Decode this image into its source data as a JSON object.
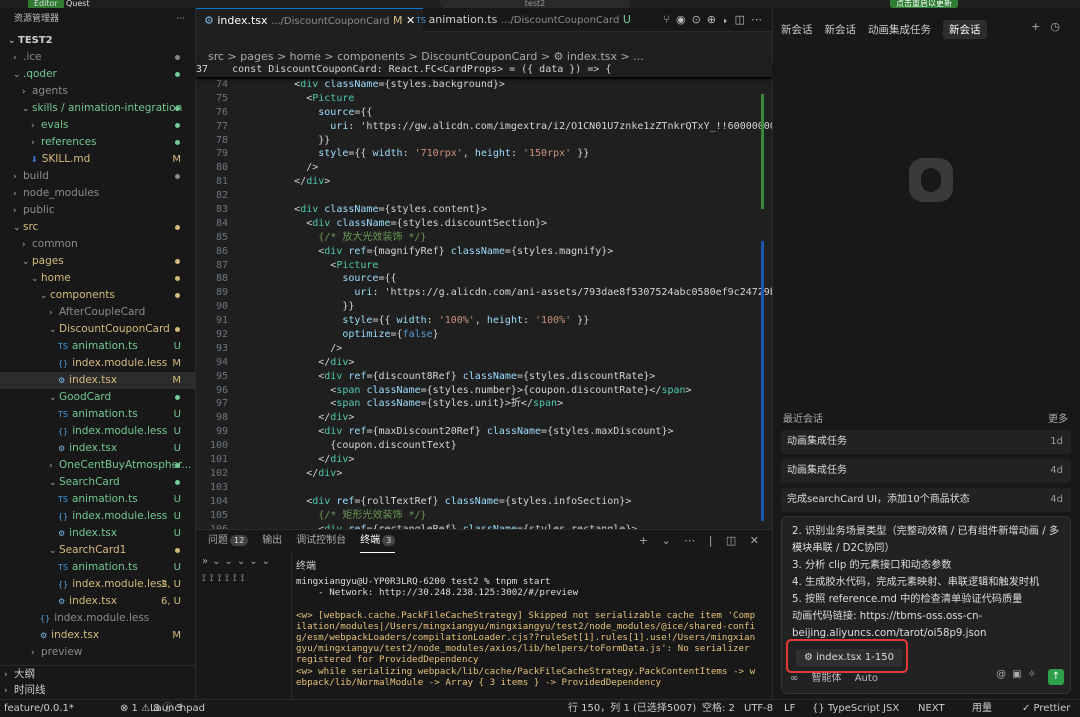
{
  "titlebar": {
    "tab1": "Editor",
    "tab2": "Quest",
    "search": "test2",
    "update": "点击重启以更新"
  },
  "explorer": {
    "title": "资源管理器",
    "root": "TEST2",
    "items": [
      {
        "label": "> .ice",
        "indent": 1,
        "color": "c-dim",
        "dot": "#888"
      },
      {
        "label": ".qoder",
        "indent": 1,
        "open": true,
        "color": "c-green",
        "dot": "#73c991"
      },
      {
        "label": "agents",
        "indent": 2,
        "color": "c-dim"
      },
      {
        "label": "skills / animation-integration",
        "indent": 2,
        "open": true,
        "color": "c-green",
        "dot": "#73c991"
      },
      {
        "label": "evals",
        "indent": 3,
        "color": "c-green",
        "dot": "#73c991"
      },
      {
        "label": "references",
        "indent": 3,
        "color": "c-green",
        "dot": "#73c991"
      },
      {
        "label": "SKILL.md",
        "indent": 3,
        "icon": "md",
        "color": "c-yellow",
        "badge": "M"
      },
      {
        "label": "build",
        "indent": 1,
        "color": "c-dim",
        "dot": "#888"
      },
      {
        "label": "node_modules",
        "indent": 1,
        "color": "c-dim"
      },
      {
        "label": "public",
        "indent": 1,
        "color": "c-dim"
      },
      {
        "label": "src",
        "indent": 1,
        "open": true,
        "color": "c-yellow",
        "dot": "#d7ba7d"
      },
      {
        "label": "common",
        "indent": 2,
        "color": "c-dim"
      },
      {
        "label": "pages",
        "indent": 2,
        "open": true,
        "color": "c-yellow",
        "dot": "#d7ba7d"
      },
      {
        "label": "home",
        "indent": 3,
        "open": true,
        "color": "c-yellow",
        "dot": "#d7ba7d"
      },
      {
        "label": "components",
        "indent": 4,
        "open": true,
        "color": "c-yellow",
        "dot": "#d7ba7d"
      },
      {
        "label": "AfterCoupleCard",
        "indent": 5,
        "color": "c-dim"
      },
      {
        "label": "DiscountCouponCard",
        "indent": 5,
        "open": true,
        "color": "c-yellow",
        "dot": "#d7ba7d"
      },
      {
        "label": "animation.ts",
        "indent": 6,
        "icon": "ts",
        "color": "c-green",
        "badge": "U"
      },
      {
        "label": "index.module.less",
        "indent": 6,
        "icon": "less",
        "color": "c-yellow",
        "badge": "M"
      },
      {
        "label": "index.tsx",
        "indent": 6,
        "icon": "gear",
        "color": "c-yellow",
        "badge": "M",
        "selected": true
      },
      {
        "label": "GoodCard",
        "indent": 5,
        "open": true,
        "color": "c-green",
        "dot": "#73c991"
      },
      {
        "label": "animation.ts",
        "indent": 6,
        "icon": "ts",
        "color": "c-green",
        "badge": "U"
      },
      {
        "label": "index.module.less",
        "indent": 6,
        "icon": "less",
        "color": "c-green",
        "badge": "U"
      },
      {
        "label": "index.tsx",
        "indent": 6,
        "icon": "gear",
        "color": "c-green",
        "badge": "U"
      },
      {
        "label": "OneCentBuyAtmospher...",
        "indent": 5,
        "color": "c-green",
        "dot": "#73c991"
      },
      {
        "label": "SearchCard",
        "indent": 5,
        "open": true,
        "color": "c-green",
        "dot": "#73c991"
      },
      {
        "label": "animation.ts",
        "indent": 6,
        "icon": "ts",
        "color": "c-green",
        "badge": "U"
      },
      {
        "label": "index.module.less",
        "indent": 6,
        "icon": "less",
        "color": "c-green",
        "badge": "U"
      },
      {
        "label": "index.tsx",
        "indent": 6,
        "icon": "gear",
        "color": "c-green",
        "badge": "U"
      },
      {
        "label": "SearchCard1",
        "indent": 5,
        "open": true,
        "color": "c-yellow",
        "dot": "#d7ba7d"
      },
      {
        "label": "animation.ts",
        "indent": 6,
        "icon": "ts",
        "color": "c-green",
        "badge": "U"
      },
      {
        "label": "index.module.less",
        "indent": 6,
        "icon": "less",
        "color": "c-yellow",
        "badge": "2, U"
      },
      {
        "label": "index.tsx",
        "indent": 6,
        "icon": "gear",
        "color": "c-yellow",
        "badge": "6, U"
      },
      {
        "label": "index.module.less",
        "indent": 4,
        "icon": "less",
        "color": "c-dim"
      },
      {
        "label": "index.tsx",
        "indent": 4,
        "icon": "gear",
        "color": "c-yellow",
        "badge": "M"
      },
      {
        "label": "preview",
        "indent": 3,
        "color": "c-dim"
      }
    ],
    "outline": "大纲",
    "timeline": "时间线"
  },
  "editor": {
    "tab_active": "index.tsx",
    "tab_active_path": ".../DiscountCouponCard",
    "tab_active_badge": "M",
    "tab2": "animation.ts",
    "tab2_path": ".../DiscountCouponCard",
    "tab2_badge": "U",
    "breadcrumb": "src > pages > home > components > DiscountCouponCard > ⚙ index.tsx > ...",
    "sticky": "37    const DiscountCouponCard: React.FC<CardProps> = ({ data }) => {"
  },
  "code": [
    {
      "n": "74",
      "h": "        <div className={styles.background}>"
    },
    {
      "n": "75",
      "h": "          <Picture"
    },
    {
      "n": "76",
      "h": "            source={{"
    },
    {
      "n": "77",
      "h": "              uri: 'https://gw.alicdn.com/imgextra/i2/O1CN01U7znke1zZTnkrQTxY_!!6000000006728-"
    },
    {
      "n": "78",
      "h": "            }}"
    },
    {
      "n": "79",
      "h": "            style={{ width: '710rpx', height: '150rpx' }}"
    },
    {
      "n": "80",
      "h": "          />"
    },
    {
      "n": "81",
      "h": "        </div>"
    },
    {
      "n": "82",
      "h": ""
    },
    {
      "n": "83",
      "h": "        <div className={styles.content}>"
    },
    {
      "n": "84",
      "h": "          <div className={styles.discountSection}>"
    },
    {
      "n": "85",
      "h": "            {/* 放大光效装饰 */}"
    },
    {
      "n": "86",
      "h": "            <div ref={magnifyRef} className={styles.magnify}>"
    },
    {
      "n": "87",
      "h": "              <Picture"
    },
    {
      "n": "88",
      "h": "                source={{"
    },
    {
      "n": "89",
      "h": "                  uri: 'https://g.alicdn.com/ani-assets/793dae8f5307524abc0580ef9c24729b/0.0.1"
    },
    {
      "n": "90",
      "h": "                }}"
    },
    {
      "n": "91",
      "h": "                style={{ width: '100%', height: '100%' }}"
    },
    {
      "n": "92",
      "h": "                optimize={false}"
    },
    {
      "n": "93",
      "h": "              />"
    },
    {
      "n": "94",
      "h": "            </div>"
    },
    {
      "n": "95",
      "h": "            <div ref={discount8Ref} className={styles.discountRate}>"
    },
    {
      "n": "96",
      "h": "              <span className={styles.number}>{coupon.discountRate}</span>"
    },
    {
      "n": "97",
      "h": "              <span className={styles.unit}>折</span>"
    },
    {
      "n": "98",
      "h": "            </div>"
    },
    {
      "n": "99",
      "h": "            <div ref={maxDiscount20Ref} className={styles.maxDiscount}>"
    },
    {
      "n": "100",
      "h": "              {coupon.discountText}"
    },
    {
      "n": "101",
      "h": "            </div>"
    },
    {
      "n": "102",
      "h": "          </div>"
    },
    {
      "n": "103",
      "h": ""
    },
    {
      "n": "104",
      "h": "          <div ref={rollTextRef} className={styles.infoSection}>"
    },
    {
      "n": "105",
      "h": "            {/* 矩形光效装饰 */}"
    },
    {
      "n": "106",
      "h": "            <div ref={rectangleRef} className={styles.rectangle}>"
    }
  ],
  "panel": {
    "tabs": [
      {
        "label": "问题",
        "count": "12"
      },
      {
        "label": "输出"
      },
      {
        "label": "调试控制台"
      },
      {
        "label": "终端",
        "count": "3",
        "active": true
      }
    ],
    "term_title": "终端",
    "lines": [
      {
        "t": "mingxiangyu@U-YP0R3LRQ-6200 test2 % tnpm start"
      },
      {
        "t": "    - Network: http://30.248.238.125:3002/#/preview"
      },
      {
        "t": ""
      },
      {
        "t": "<w> [webpack.cache.PackFileCacheStrategy] Skipped not serializable cache item 'Compilation/modules|/Users/mingxiangyu/mingxiangyu/test2/node_modules/@ice/shared-config/esm/webpackLoaders/compilationLoader.cjs??ruleSet[1].rules[1].use!/Users/mingxiangyu/mingxiangyu/test2/node_modules/axios/lib/helpers/toFormData.js': No serializer registered for ProvidedDependency",
        "w": true
      },
      {
        "t": "<w> while serializing webpack/lib/cache/PackFileCacheStrategy.PackContentItems -> webpack/lib/NormalModule -> Array { 3 items } -> ProvidedDependency",
        "w": true
      }
    ]
  },
  "chat": {
    "tabs": [
      "新会话",
      "新会话",
      "动画集成任务",
      "新会话"
    ],
    "recent_title": "最近会话",
    "recent_more": "更多",
    "recent": [
      {
        "label": "动画集成任务",
        "age": "1d"
      },
      {
        "label": "动画集成任务",
        "age": "4d"
      },
      {
        "label": "完成searchCard UI，添加10个商品状态",
        "age": "4d"
      }
    ],
    "message": [
      "2. 识别业务场景类型（完整动效稿 / 已有组件新增动画 / 多模块串联 / D2C协同）",
      "3. 分析 clip 的元素接口和动态参数",
      "4. 生成胶水代码，完成元素映射、串联逻辑和触发时机",
      "5. 按照 reference.md 中的检查清单验证代码质量",
      "动画代码链接: https://tbms-oss.oss-cn-beijing.aliyuncs.com/tarot/oi58p9.json"
    ],
    "chip": "⚙ index.tsx 1-150",
    "agent": "智能体",
    "mode": "Auto"
  },
  "status": {
    "branch": "feature/0.0.1*",
    "errors": "⊗ 1 ⚠ 8 ⓘ 3",
    "launch": "Launchpad",
    "pos": "行 150，列 1 (已选择5007)",
    "spaces": "空格: 2",
    "enc": "UTF-8",
    "eol": "LF",
    "lang": "{} TypeScript JSX",
    "next": "NEXT",
    "usage": "用量",
    "prettier": "✓ Prettier"
  }
}
